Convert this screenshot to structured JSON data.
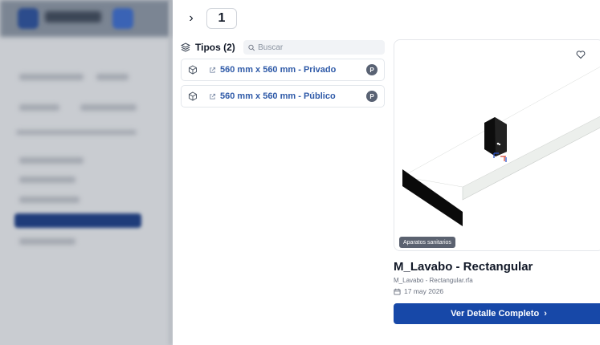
{
  "navigation": {
    "chevron_glyph": "›",
    "page_value": "1"
  },
  "types": {
    "label": "Tipos (2)",
    "search_placeholder": "Buscar",
    "items": [
      {
        "label": "560 mm x 560 mm - Privado",
        "badge": "P"
      },
      {
        "label": "560 mm x 560 mm - Público",
        "badge": "P"
      }
    ]
  },
  "preview": {
    "category_badge": "Aparatos sanitarios"
  },
  "family": {
    "title": "M_Lavabo - Rectangular",
    "filename": "M_Lavabo - Rectangular.rfa",
    "date": "17 may 2026"
  },
  "actions": {
    "detail_label": "Ver Detalle Completo",
    "detail_chevron": "›"
  },
  "colors": {
    "accent": "#1748a8",
    "link": "#2f5aa8"
  }
}
